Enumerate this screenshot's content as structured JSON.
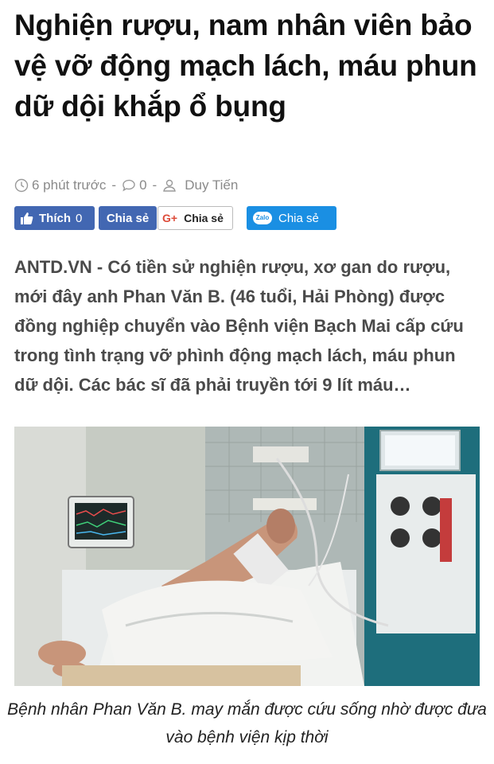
{
  "article": {
    "title": "Nghiện rượu, nam nhân viên bảo vệ vỡ động mạch lách, máu phun dữ dội khắp ổ bụng",
    "meta": {
      "time": "6 phút trước",
      "comments": "0",
      "author": "Duy Tiến",
      "separator": "-"
    },
    "share": {
      "like_label": "Thích",
      "like_count": "0",
      "facebook_share": "Chia sẻ",
      "gplus_icon": "G+",
      "gplus_share": "Chia sẻ",
      "zalo_badge": "Zalo",
      "zalo_share": "Chia sẻ"
    },
    "lead_source": "ANTD.VN -",
    "lead_text": " Có tiền sử nghiện rượu, xơ gan do rượu, mới đây anh Phan Văn B. (46 tuổi, Hải Phòng) được đồng nghiệp chuyển vào Bệnh viện Bạch Mai cấp cứu trong tình trạng vỡ phình động mạch lách, máu phun dữ dội. Các bác sĩ đã phải truyền tới 9 lít máu…",
    "caption": "Bệnh nhân Phan Văn B. may mắn được cứu sống nhờ được đưa vào bệnh viện kịp thời"
  },
  "icons": {
    "time": "clock-icon",
    "comments": "comment-icon",
    "author": "user-icon",
    "like": "thumbs-up-icon"
  },
  "colors": {
    "facebook": "#4267b2",
    "zalo": "#1a8fe3",
    "gplus": "#dd4b39"
  }
}
